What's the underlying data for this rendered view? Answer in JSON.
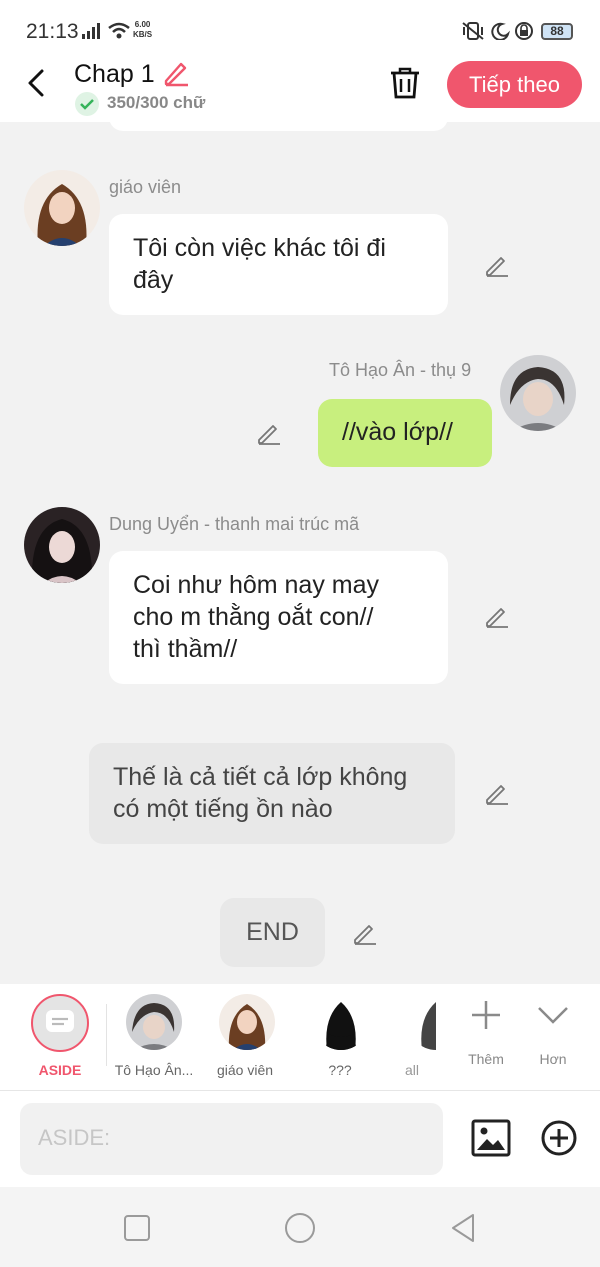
{
  "status_bar": {
    "time": "21:13",
    "net_speed_top": "6.00",
    "net_speed_bottom": "KB/S",
    "battery": "88"
  },
  "header": {
    "title": "Chap 1",
    "word_count": "350/300 chữ",
    "next_label": "Tiếp theo"
  },
  "messages": [
    {
      "sender": "giáo viên",
      "text_lines": [
        "Tôi còn việc khác tôi đi",
        "đây"
      ]
    },
    {
      "sender": "Tô Hạo Ân - thụ 9",
      "text": "//vào lớp//"
    },
    {
      "sender": "Dung Uyển - thanh mai trúc mã",
      "text_lines": [
        "Coi như hôm nay may",
        "cho m thằng oắt con//",
        "thì thầm//"
      ]
    },
    {
      "text_lines": [
        "Thế là cả tiết cả lớp không",
        "có một tiếng ồn nào"
      ]
    },
    {
      "text": "END"
    }
  ],
  "characters": [
    {
      "label": "ASIDE"
    },
    {
      "label": "Tô Hạo Ân..."
    },
    {
      "label": "giáo viên"
    },
    {
      "label": "???"
    },
    {
      "label": "all"
    },
    {
      "label": "Thêm"
    },
    {
      "label": "Hơn"
    }
  ],
  "input": {
    "placeholder": "ASIDE:"
  },
  "colors": {
    "accent": "#f0566d",
    "green_bubble": "#c8ef7e",
    "aside_bubble": "#e8e8e8"
  }
}
